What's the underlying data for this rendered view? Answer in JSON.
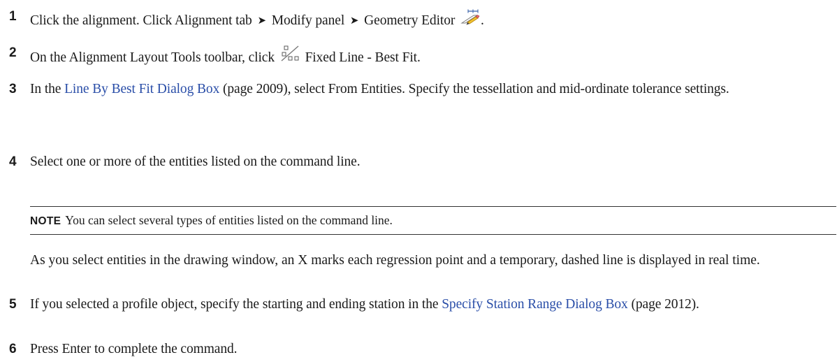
{
  "steps": [
    {
      "number": "1",
      "parts": [
        "Click the alignment. Click Alignment tab",
        "Modify panel",
        "Geometry Editor",
        "."
      ],
      "icon": "geometry-editor-icon"
    },
    {
      "number": "2",
      "before": "On the Alignment Layout Tools toolbar, click",
      "after": "Fixed Line - Best Fit.",
      "icon": "fixed-line-best-fit-icon"
    },
    {
      "number": "3",
      "before": "In the",
      "link": "Line By Best Fit Dialog Box",
      "after": "(page 2009), select From Entities. Specify the tessellation and mid-ordinate tolerance settings."
    },
    {
      "number": "4",
      "text": "Select one or more of the entities listed on the command line."
    },
    {
      "number": "5",
      "before": "If you selected a profile object, specify the starting and ending station in the",
      "link": "Specify Station Range Dialog Box",
      "after": "(page 2012)."
    },
    {
      "number": "6",
      "text": "Press Enter to complete the command."
    }
  ],
  "note": {
    "label": "NOTE",
    "text": "You can select several types of entities listed on the command line."
  },
  "paragraph": "As you select entities in the drawing window, an X marks each regression point and a temporary, dashed line is displayed in real time.",
  "arrow_glyph": "➤",
  "colors": {
    "link": "#2a4ea8",
    "text": "#1a1a1a"
  }
}
